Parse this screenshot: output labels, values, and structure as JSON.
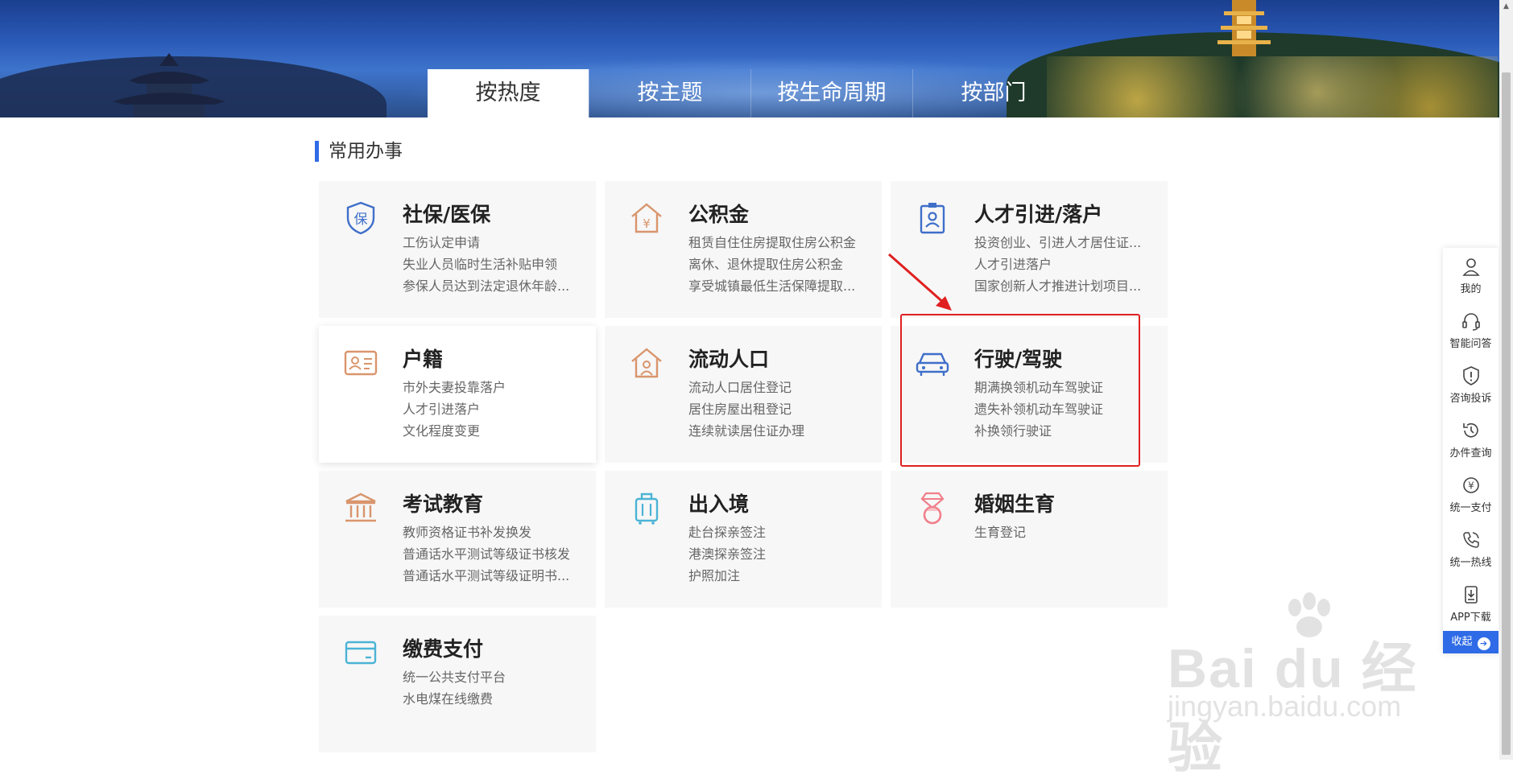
{
  "tabs": [
    {
      "label": "按热度",
      "active": true
    },
    {
      "label": "按主题",
      "active": false
    },
    {
      "label": "按生命周期",
      "active": false
    },
    {
      "label": "按部门",
      "active": false
    }
  ],
  "section_title": "常用办事",
  "cards": [
    {
      "icon": "shield-bao-icon",
      "title": "社保/医保",
      "items": [
        "工伤认定申请",
        "失业人员临时生活补贴申领",
        "参保人员达到法定退休年龄..."
      ]
    },
    {
      "icon": "house-yen-icon",
      "title": "公积金",
      "items": [
        "租赁自住住房提取住房公积金",
        "离休、退休提取住房公积金",
        "享受城镇最低生活保障提取..."
      ]
    },
    {
      "icon": "badge-person-icon",
      "title": "人才引进/落户",
      "items": [
        "投资创业、引进人才居住证...",
        "人才引进落户",
        "国家创新人才推进计划项目..."
      ]
    },
    {
      "icon": "id-card-icon",
      "title": "户籍",
      "items": [
        "市外夫妻投靠落户",
        "人才引进落户",
        "文化程度变更"
      ]
    },
    {
      "icon": "house-person-icon",
      "title": "流动人口",
      "items": [
        "流动人口居住登记",
        "居住房屋出租登记",
        "连续就读居住证办理"
      ]
    },
    {
      "icon": "car-icon",
      "title": "行驶/驾驶",
      "items": [
        "期满换领机动车驾驶证",
        "遗失补领机动车驾驶证",
        "补换领行驶证"
      ]
    },
    {
      "icon": "building-columns-icon",
      "title": "考试教育",
      "items": [
        "教师资格证书补发换发",
        "普通话水平测试等级证书核发",
        "普通话水平测试等级证明书..."
      ]
    },
    {
      "icon": "luggage-icon",
      "title": "出入境",
      "items": [
        "赴台探亲签注",
        "港澳探亲签注",
        "护照加注"
      ]
    },
    {
      "icon": "diamond-ring-icon",
      "title": "婚姻生育",
      "items": [
        "生育登记"
      ]
    },
    {
      "icon": "wallet-card-icon",
      "title": "缴费支付",
      "items": [
        "统一公共支付平台",
        "水电煤在线缴费"
      ]
    }
  ],
  "floatbar": {
    "items": [
      {
        "icon": "user-icon",
        "label": "我的"
      },
      {
        "icon": "headset-icon",
        "label": "智能问答"
      },
      {
        "icon": "shield-alert-icon",
        "label": "咨询投诉"
      },
      {
        "icon": "history-icon",
        "label": "办件查询"
      },
      {
        "icon": "yen-circle-icon",
        "label": "统一支付"
      },
      {
        "icon": "phone-icon",
        "label": "统一热线"
      },
      {
        "icon": "download-icon",
        "label": "APP下载"
      }
    ],
    "collapse_label": "收起"
  },
  "watermark": {
    "line1": "Bai du 经验",
    "line2": "jingyan.baidu.com"
  },
  "colors": {
    "accent": "#2f6be6",
    "highlight": "#e02020",
    "icon_orange": "#d9956c",
    "icon_blue": "#3f6fc9",
    "icon_cyan": "#4bb3d6",
    "icon_pink": "#f07f8a"
  }
}
